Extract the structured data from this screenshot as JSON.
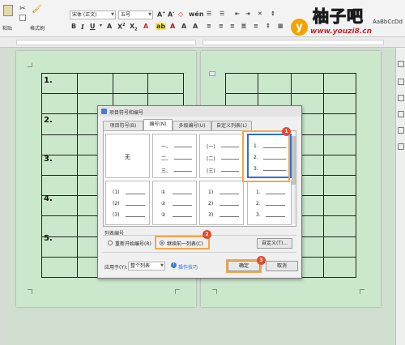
{
  "toolbar": {
    "paste_label": "粘贴",
    "format_painter_label": "格式刷",
    "font_name": "宋体 (正文)",
    "font_size": "五号",
    "styles_preview": "AaBbCcDd"
  },
  "logo": {
    "badge": "y",
    "title": "柚子吧",
    "url": "www.youzi8.cn"
  },
  "document": {
    "row_numbers": [
      "1.",
      "2.",
      "3.",
      "4.",
      "5."
    ]
  },
  "dialog": {
    "title": "项目符号和编号",
    "tabs": [
      "项目符号(B)",
      "编号(N)",
      "多级编号(U)",
      "自定义列表(L)"
    ],
    "active_tab": "编号(N)",
    "none_label": "无",
    "styles": [
      [
        "一、",
        "二、",
        "三、"
      ],
      [
        "(一)",
        "(二)",
        "(三)"
      ],
      [
        "1.",
        "2.",
        "3."
      ],
      [
        "(1)",
        "(2)",
        "(3)"
      ],
      [
        "①",
        "②",
        "③"
      ],
      [
        "1)",
        "2)",
        "3)"
      ],
      [
        "1.",
        "2.",
        "3."
      ]
    ],
    "list_numbering_label": "列表编号",
    "restart_option": "重新开始编号(R)",
    "continue_option": "继续前一列表(C)",
    "selected_option": "继续前一列表(C)",
    "customize_button": "自定义(T)...",
    "apply_to_label": "应用于(Y):",
    "apply_to_value": "整个列表",
    "tips_link": "操作技巧",
    "ok_button": "确定",
    "cancel_button": "取消",
    "steps": [
      "1",
      "2",
      "3"
    ]
  },
  "colors": {
    "page_bg": "#cce8cc",
    "highlight": "#f6a64a",
    "step_badge": "#e54a2e",
    "logo_orange": "#f5a200",
    "url_red": "#c8242a"
  }
}
